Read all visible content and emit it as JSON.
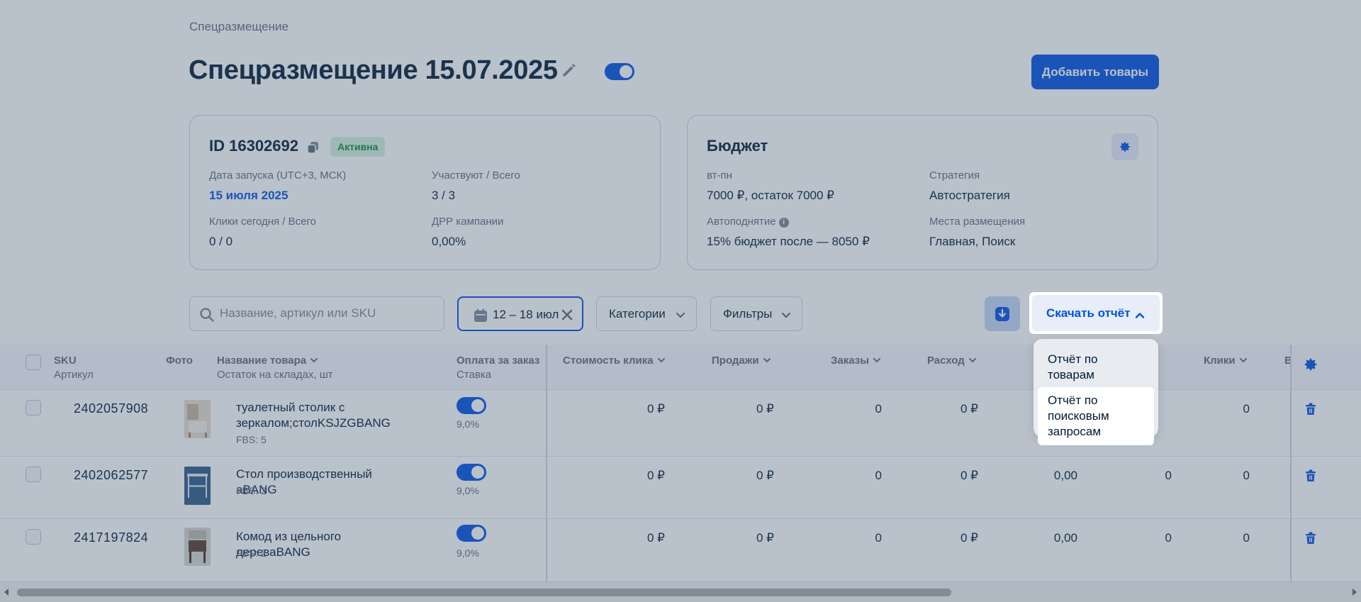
{
  "breadcrumb": "Спецразмещение",
  "page_title": "Спецразмещение 15.07.2025",
  "add_products_label": "Добавить товары",
  "campaign": {
    "id_label": "ID 16302692",
    "status": "Активна",
    "launch_date_label": "Дата запуска (UTC+3, МСК)",
    "launch_date": "15 июля 2025",
    "participants_label": "Участвуют / Всего",
    "participants": "3 / 3",
    "clicks_label": "Клики сегодня / Всего",
    "clicks": "0 / 0",
    "drr_label": "ДРР кампании",
    "drr": "0,00%"
  },
  "budget": {
    "title": "Бюджет",
    "period_label": "вт-пн",
    "period_value": "7000 ₽, остаток 7000 ₽",
    "strategy_label": "Стратегия",
    "strategy": "Автостратегия",
    "autoraise_label": "Автоподнятие",
    "autoraise_value": "15% бюджет после — 8050 ₽",
    "placement_label": "Места размещения",
    "placement": "Главная, Поиск"
  },
  "toolbar": {
    "search_placeholder": "Название, артикул или SKU",
    "date_range": "12 – 18 июл",
    "categories": "Категории",
    "filters": "Фильтры",
    "download_report": "Скачать отчёт"
  },
  "report_menu": {
    "items": [
      "Отчёт по товарам",
      "Отчёт по поисковым запросам"
    ]
  },
  "table": {
    "headers": {
      "sku": "SKU",
      "article": "Артикул",
      "photo": "Фото",
      "name": "Название товара",
      "stock": "Остаток на складах, шт",
      "pay_per_order": "Оплата за заказ",
      "bid": "Ставка",
      "click_cost": "Стоимость клика",
      "sales": "Продажи",
      "orders": "Заказы",
      "spend": "Расход",
      "clicks": "Клики",
      "cut": "В"
    },
    "rows": [
      {
        "sku": "2402057908",
        "name": "туалетный столик с зеркалом;столKSJZGBANG",
        "stock": "FBS: 5",
        "rate": "9,0%",
        "click_cost": "0 ₽",
        "sales": "0 ₽",
        "orders": "0",
        "spend": "0 ₽",
        "drr": "",
        "col7": "",
        "clicks": "0"
      },
      {
        "sku": "2402062577",
        "name": "Стол производственный aBANG",
        "stock": "FBS: 2",
        "rate": "9,0%",
        "click_cost": "0 ₽",
        "sales": "0 ₽",
        "orders": "0",
        "spend": "0 ₽",
        "drr": "0,00",
        "col7": "0",
        "clicks": "0"
      },
      {
        "sku": "2417197824",
        "name": "Комод из цельного дереваBANG",
        "stock": "FBS: 2",
        "rate": "9,0%",
        "click_cost": "0 ₽",
        "sales": "0 ₽",
        "orders": "0",
        "spend": "0 ₽",
        "drr": "0,00",
        "col7": "0",
        "clicks": "0"
      }
    ]
  },
  "colors": {
    "accent": "#0050e0",
    "status_bg": "#d4f3dc",
    "status_text": "#0a8a3c",
    "overlay": "#465c76"
  }
}
